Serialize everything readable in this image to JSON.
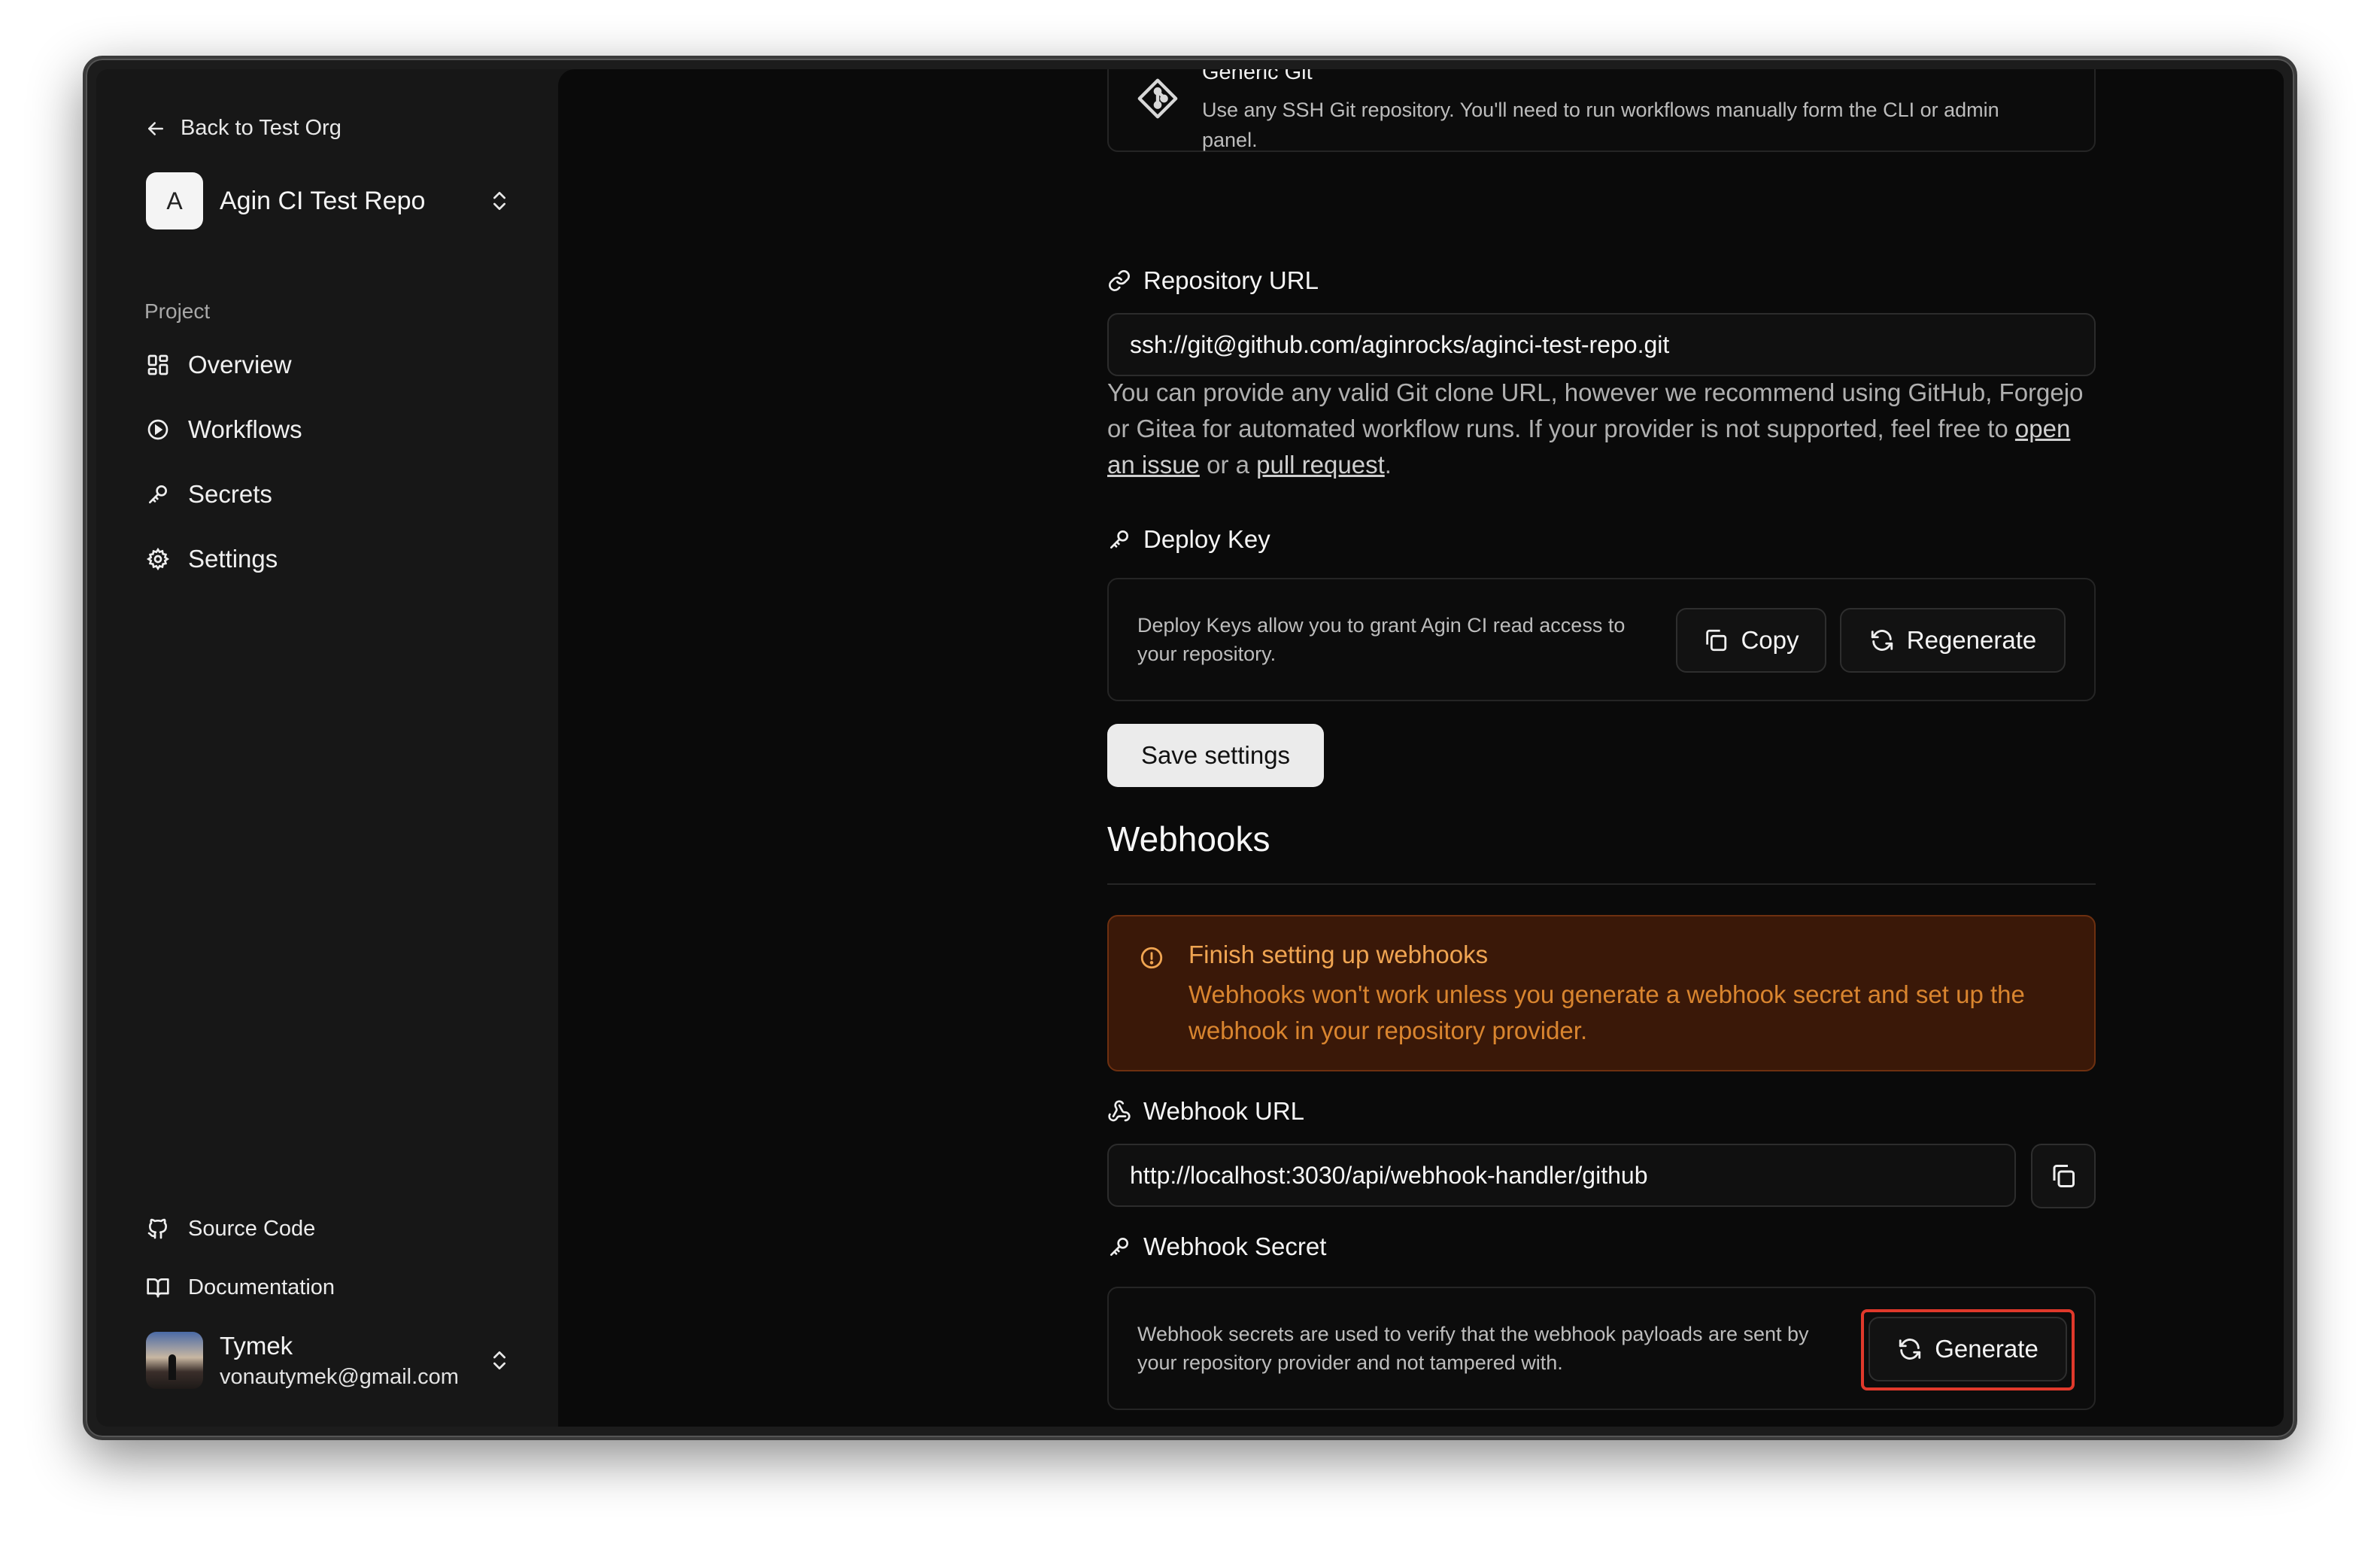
{
  "sidebar": {
    "back_label": "Back to Test Org",
    "project": {
      "avatar_letter": "A",
      "name": "Agin CI Test Repo"
    },
    "group_label": "Project",
    "nav": [
      {
        "label": "Overview",
        "icon": "overview-icon"
      },
      {
        "label": "Workflows",
        "icon": "play-circle-icon"
      },
      {
        "label": "Secrets",
        "icon": "key-icon"
      },
      {
        "label": "Settings",
        "icon": "gear-icon"
      }
    ],
    "footer": [
      {
        "label": "Source Code",
        "icon": "github-icon"
      },
      {
        "label": "Documentation",
        "icon": "book-icon"
      }
    ],
    "user": {
      "name": "Tymek",
      "email": "vonautymek@gmail.com"
    }
  },
  "main": {
    "generic_git": {
      "title": "Generic Git",
      "description": "Use any SSH Git repository. You'll need to run workflows manually form the CLI or admin panel."
    },
    "repository_url": {
      "label": "Repository URL",
      "value": "ssh://git@github.com/aginrocks/aginci-test-repo.git",
      "help_prefix": "You can provide any valid Git clone URL, however we recommend using GitHub, Forgejo or Gitea for automated workflow runs. If your provider is not supported, feel free to ",
      "help_link1": "open an issue",
      "help_middle": " or a ",
      "help_link2": "pull request",
      "help_suffix": "."
    },
    "deploy_key": {
      "label": "Deploy Key",
      "description": "Deploy Keys allow you to grant Agin CI read access to your repository.",
      "copy_label": "Copy",
      "regenerate_label": "Regenerate"
    },
    "save_label": "Save settings",
    "webhooks": {
      "title": "Webhooks",
      "alert_title": "Finish setting up webhooks",
      "alert_desc": "Webhooks won't work unless you generate a webhook secret and set up the webhook in your repository provider.",
      "url_label": "Webhook URL",
      "url_value": "http://localhost:3030/api/webhook-handler/github",
      "secret_label": "Webhook Secret",
      "secret_desc": "Webhook secrets are used to verify that the webhook payloads are sent by your repository provider and not tampered with.",
      "generate_label": "Generate"
    }
  },
  "colors": {
    "accent_highlight": "#e0392b",
    "alert_bg": "#3a1808",
    "alert_text": "#f0a552"
  }
}
